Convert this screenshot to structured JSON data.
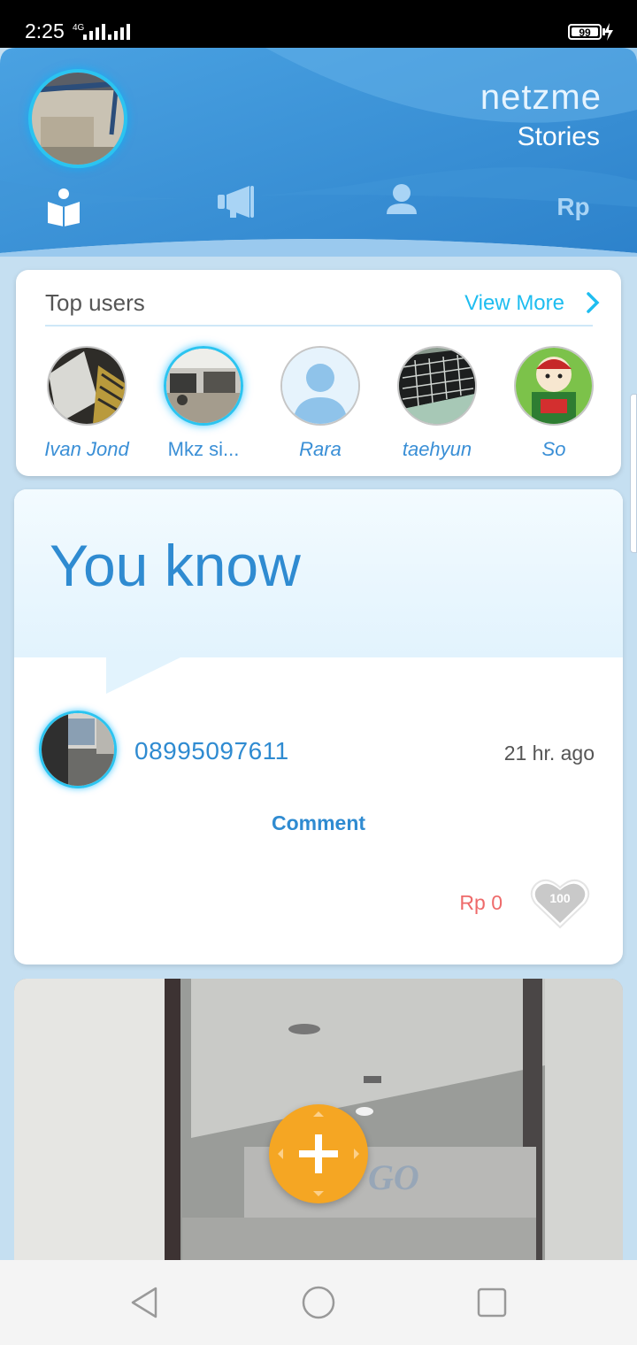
{
  "status_bar": {
    "time": "2:25",
    "network": "4G",
    "battery": "99"
  },
  "header": {
    "brand": "netzme",
    "section": "Stories",
    "tabs": [
      {
        "icon": "book-reader-icon",
        "active": true
      },
      {
        "icon": "megaphone-icon",
        "active": false
      },
      {
        "icon": "person-icon",
        "active": false
      },
      {
        "label": "Rp",
        "active": false
      }
    ]
  },
  "top_users": {
    "title": "Top users",
    "view_more": "View More",
    "users": [
      {
        "name": "Ivan Jond",
        "active": false
      },
      {
        "name": "Mkz si...",
        "active": true
      },
      {
        "name": "Rara",
        "active": false
      },
      {
        "name": "taehyun",
        "active": false
      },
      {
        "name": "So",
        "active": false
      }
    ]
  },
  "story": {
    "title": "You know",
    "author": "08995097611",
    "time_ago": "21 hr. ago",
    "comment_label": "Comment",
    "rp_amount": "Rp 0",
    "likes": "100"
  },
  "colors": {
    "primary_blue": "#2f8bd1",
    "header_blue": "#3a92d8",
    "accent_cyan": "#2bc4f0",
    "fab_orange": "#f5a623",
    "rp_red": "#ee6a6a"
  }
}
